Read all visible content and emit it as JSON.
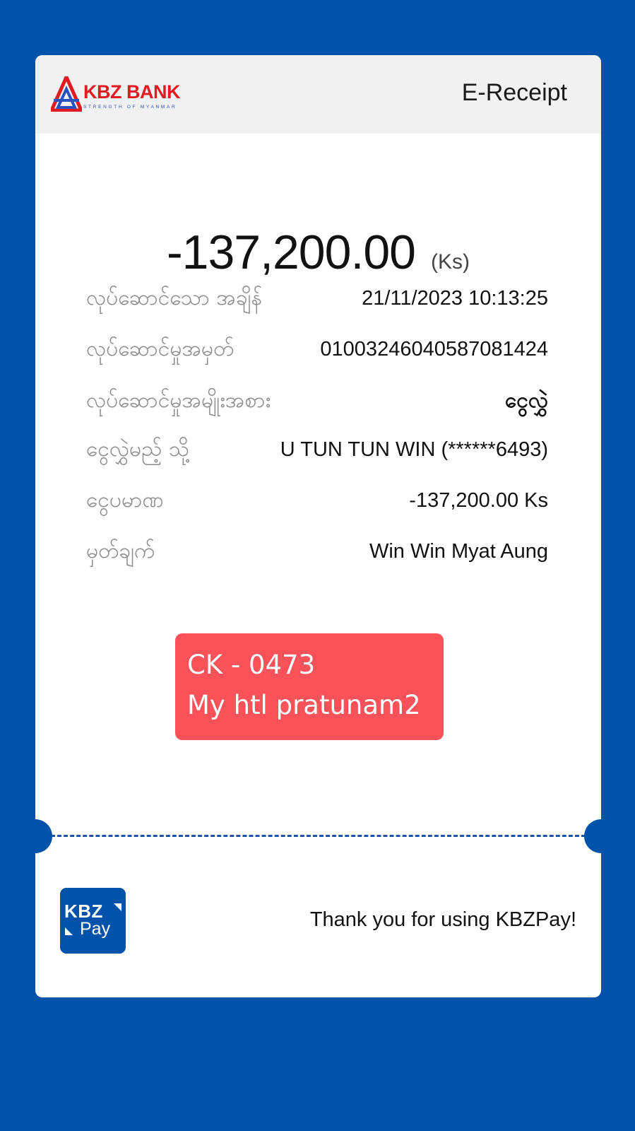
{
  "colors": {
    "background": "#0052aa",
    "card": "#ffffff",
    "header": "#f1f1f1",
    "brand_red": "#e21b23",
    "note_red": "#fb525a",
    "label_gray": "#8c8c8c"
  },
  "header": {
    "logo_icon": "kbz-bank-logo",
    "logo_name": "KBZ BANK",
    "logo_tagline": "STRENGTH OF MYANMAR",
    "title": "E-Receipt"
  },
  "amount": {
    "value": "-137,200.00",
    "unit": "(Ks)"
  },
  "details": [
    {
      "label": "လုပ်ဆောင်သော အချိန်",
      "value": "21/11/2023 10:13:25"
    },
    {
      "label": "လုပ်ဆောင်မှုအမှတ်",
      "value": "01003246040587081424"
    },
    {
      "label": "လုပ်ဆောင်မှုအမျိုးအစား",
      "value": "ငွေလွှဲ"
    },
    {
      "label": "ငွေလွှဲမည့် သို့",
      "value": "U TUN TUN WIN (******6493)"
    },
    {
      "label": "ငွေပမာဏ",
      "value": "-137,200.00 Ks"
    },
    {
      "label": "မှတ်ချက်",
      "value": "Win Win Myat Aung"
    }
  ],
  "note": {
    "line1": "CK - 0473",
    "line2": "My htl pratunam2"
  },
  "footer": {
    "pay_logo_icon": "kbzpay-logo",
    "pay_logo_top": "KBZ",
    "pay_logo_bottom": "Pay",
    "thanks": "Thank you for using KBZPay!"
  }
}
